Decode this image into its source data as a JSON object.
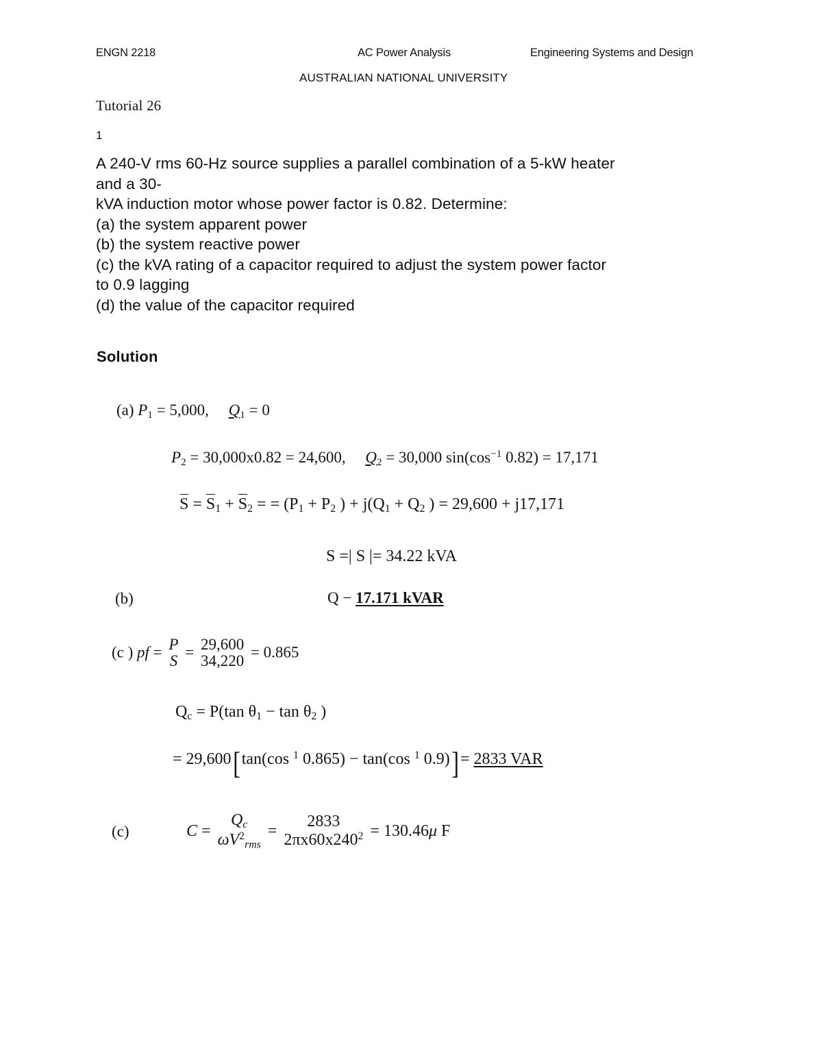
{
  "header": {
    "course_code": "ENGN 2218",
    "topic": "AC Power Analysis",
    "department": "Engineering Systems and Design",
    "university": "AUSTRALIAN NATIONAL UNIVERSITY"
  },
  "document": {
    "title": "Tutorial 26",
    "item_number": "1",
    "solution_heading": "Solution"
  },
  "problem": {
    "line1": "A 240-V rms 60-Hz source supplies a parallel combination of a 5-kW heater",
    "line2": "and a 30-",
    "line3": "kVA induction motor whose power factor is 0.82. Determine:",
    "line4": "(a) the system apparent power",
    "line5": "(b) the system reactive power",
    "line6": "(c) the kVA rating of a capacitor required to adjust the system power factor",
    "line7": "to 0.9 lagging",
    "line8": "(d) the value of the capacitor required"
  },
  "solution": {
    "part_a": {
      "label": "(a)",
      "p1_symbol": "P",
      "p1_sub": "1",
      "p1_value": "= 5,000,",
      "q1_symbol": "Q",
      "q1_sub": "1",
      "q1_value": "= 0",
      "p2_symbol": "P",
      "p2_sub": "2",
      "p2_expr": "= 30,000x0.82 = 24,600,",
      "q2_symbol": "Q",
      "q2_sub": "2",
      "q2_expr_a": "= 30,000 sin(cos",
      "q2_exp": "−1",
      "q2_expr_b": "0.82) = 17,171",
      "s_eq": "= (P",
      "s_sub1": "1",
      "s_plus": "+ P",
      "s_sub2": "2",
      "s_close": ") + j(Q",
      "s_sub3": "1",
      "s_plus2": "+ Q",
      "s_sub4": "2",
      "s_result": ") = 29,600 + j17,171",
      "s_symbol": "S",
      "smag_text": "S =| S |= 34.22 kVA"
    },
    "part_b": {
      "label": "(b)",
      "prefix": "Q −",
      "value": "17.171 kVAR"
    },
    "part_c": {
      "label": "(c )",
      "pf_symbol": "pf",
      "eq1": "=",
      "num1": "P",
      "den1": "S",
      "eq2": "=",
      "num2": "29,600",
      "den2": "34,220",
      "eq3": "= 0.865",
      "qc_symbol": "Q",
      "qc_sub": "c",
      "qc_line1": "= P(tan θ",
      "qc_sub1": "1",
      "qc_minus": "− tan θ",
      "qc_sub2": "2",
      "qc_close": ")",
      "qc_line2_a": "= 29,600",
      "qc_line2_b": "tan(cos",
      "qc_exp1": "1",
      "qc_line2_c": "0.865) − tan(cos",
      "qc_exp2": "1",
      "qc_line2_d": "0.9)",
      "qc_result": "2833 VAR"
    },
    "part_d": {
      "label": "(c)",
      "c_symbol": "C",
      "eq1": "=",
      "num1": "Q",
      "num1_sub": "c",
      "den1_a": "ωV",
      "den1_exp": "2",
      "den1_sub": "rms",
      "eq2": "=",
      "num2": "2833",
      "den2_a": "2πx60x240",
      "den2_exp": "2",
      "eq3": "= 130.46",
      "mu": "μ",
      "farad": "F"
    }
  }
}
